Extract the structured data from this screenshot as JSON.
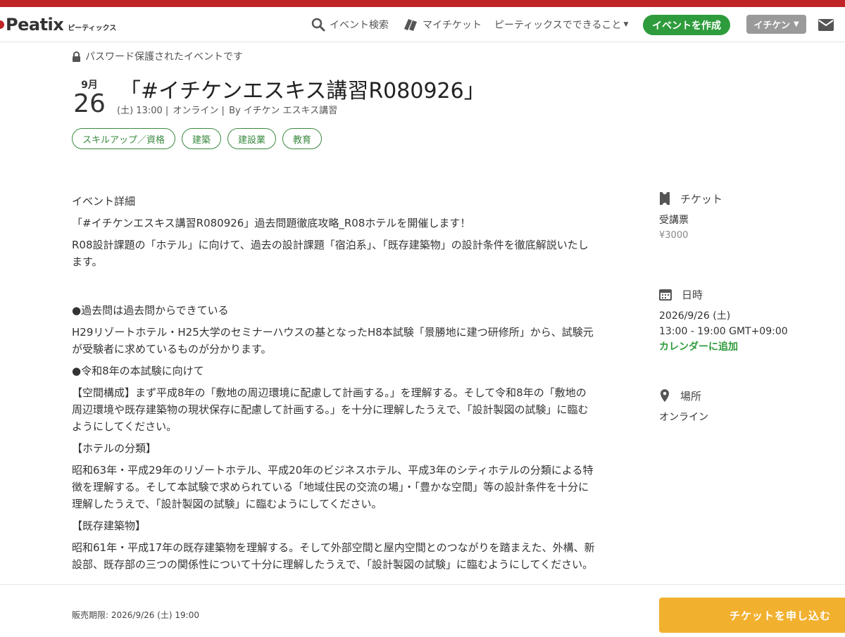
{
  "header": {
    "logo_text": "Peatix",
    "logo_sub": "ピーティックス",
    "nav": {
      "search": "イベント検索",
      "my_tickets": "マイチケット",
      "features": "ピーティックスでできること"
    },
    "create_event": "イベントを作成",
    "user": "イチケン"
  },
  "event": {
    "password_notice": "パスワード保護されたイベントです",
    "month": "9月",
    "day": "26",
    "title": "「#イチケンエスキス講習R080926」",
    "meta_time": "(土) 13:00 |",
    "meta_place": "オンライン |",
    "meta_by": "By イチケン エスキス講習",
    "tags": [
      "スキルアップ／資格",
      "建築",
      "建設業",
      "教育"
    ]
  },
  "details": {
    "heading": "イベント詳細",
    "p1": "「#イチケンエスキス講習R080926」過去問題徹底攻略_R08ホテルを開催します！",
    "p2": "R08設計課題の「ホテル」に向けて、過去の設計課題「宿泊系」、「既存建築物」の設計条件を徹底解説いたします。",
    "p3": "●過去問は過去問からできている",
    "p4": "H29リゾートホテル・H25大学のセミナーハウスの基となったH8本試験「景勝地に建つ研修所」から、試験元が受験者に求めているものが分かります。",
    "p5": "●令和8年の本試験に向けて",
    "p6": "【空間構成】まず平成8年の「敷地の周辺環境に配慮して計画する。」を理解する。そして令和8年の「敷地の周辺環境や既存建築物の現状保存に配慮して計画する。」を十分に理解したうえで、「設計製図の試験」に臨むようにしてください。",
    "p7": "【ホテルの分類】",
    "p8": "昭和63年・平成29年のリゾートホテル、平成20年のビジネスホテル、平成3年のシティホテルの分類による特徴を理解する。そして本試験で求められている「地域住民の交流の場」・「豊かな空間」等の設計条件を十分に理解したうえで、「設計製図の試験」に臨むようにしてください。",
    "p9": "【既存建築物】",
    "p10": "昭和61年・平成17年の既存建築物を理解する。そして外部空間と屋内空間とのつながりを踏まえた、外構、新設部、既存部の三つの関係性について十分に理解したうえで、「設計製図の試験」に臨むようにしてください。"
  },
  "sidebar": {
    "ticket_heading": "チケット",
    "ticket_name": "受講票",
    "ticket_price": "¥3000",
    "datetime_heading": "日時",
    "date": "2026/9/26 (土)",
    "time": "13:00 - 19:00 GMT+09:00",
    "add_calendar": "カレンダーに追加",
    "place_heading": "場所",
    "place": "オンライン"
  },
  "footer": {
    "deadline": "販売期限: 2026/9/26 (土) 19:00",
    "buy_button": "チケットを申し込む"
  },
  "colors": {
    "brand_red": "#c02326",
    "accent_green": "#2e9c3c",
    "buy_orange": "#f2b02f"
  }
}
